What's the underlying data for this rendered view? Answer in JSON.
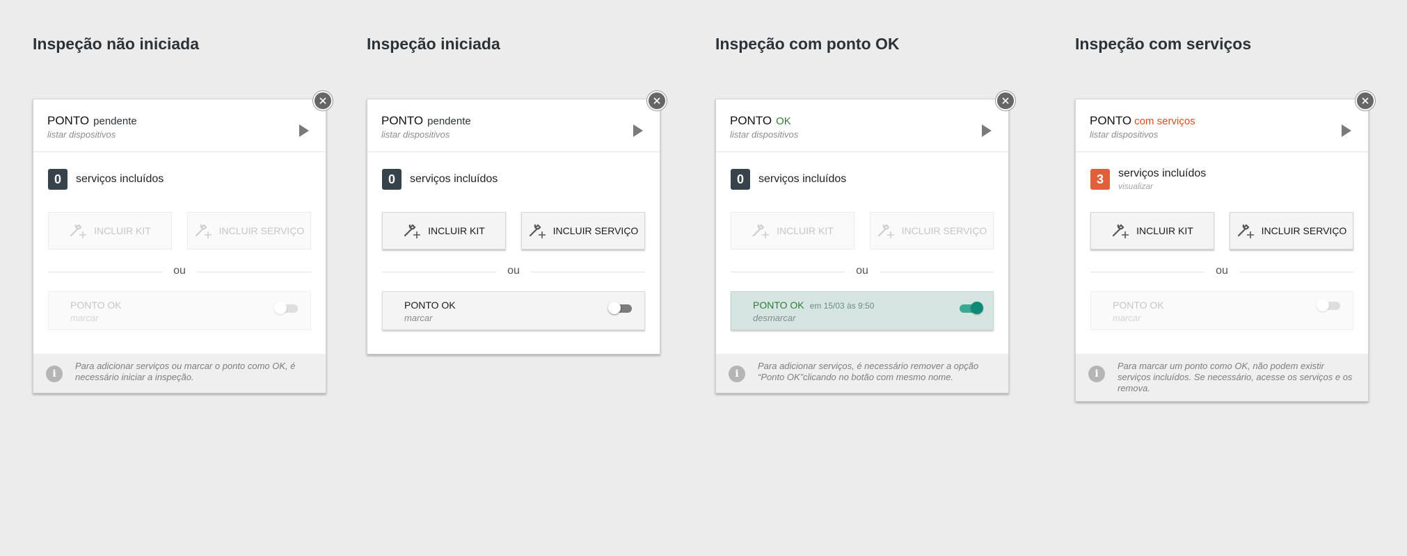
{
  "columns": [
    {
      "heading": "Inspeção não iniciada",
      "point_label": "PONTO",
      "point_status": "pendente",
      "list_devices": "listar dispositivos",
      "services_count": "0",
      "services_label": "serviços incluídos",
      "include_kit": "INCLUIR KIT",
      "include_service": "INCLUIR SERVIÇO",
      "or_label": "ou",
      "point_ok_label": "PONTO OK",
      "point_ok_sub": "marcar",
      "footer_text": "Para adicionar serviços ou marcar o ponto como OK, é necessário iniciar a inspeção."
    },
    {
      "heading": "Inspeção iniciada",
      "point_label": "PONTO",
      "point_status": "pendente",
      "list_devices": "listar dispositivos",
      "services_count": "0",
      "services_label": "serviços incluídos",
      "include_kit": "INCLUIR KIT",
      "include_service": "INCLUIR SERVIÇO",
      "or_label": "ou",
      "point_ok_label": "PONTO OK",
      "point_ok_sub": "marcar"
    },
    {
      "heading": "Inspeção com ponto OK",
      "point_label": "PONTO",
      "point_status": "OK",
      "list_devices": "listar dispositivos",
      "services_count": "0",
      "services_label": "serviços incluídos",
      "include_kit": "INCLUIR KIT",
      "include_service": "INCLUIR SERVIÇO",
      "or_label": "ou",
      "point_ok_label": "PONTO OK",
      "point_ok_date": "em 15/03 às 9:50",
      "point_ok_sub": "desmarcar",
      "footer_text": "Para adicionar serviços, é necessário remover a opção “Ponto OK”clicando no botão com mesmo nome."
    },
    {
      "heading": "Inspeção com serviços",
      "point_label": "PONTO",
      "point_status": "com serviços",
      "list_devices": "listar dispositivos",
      "services_count": "3",
      "services_label": "serviços incluídos",
      "services_sub": "visualizar",
      "include_kit": "INCLUIR KIT",
      "include_service": "INCLUIR SERVIÇO",
      "or_label": "ou",
      "point_ok_label": "PONTO OK",
      "point_ok_sub": "marcar",
      "footer_text": "Para marcar um ponto como OK, não podem existir serviços incluídos. Se necessário, acesse os serviços e os remova."
    }
  ],
  "icons": {
    "close": "close-icon",
    "arrow": "play-arrow-icon",
    "tool": "wrench-add-icon",
    "info": "info-icon"
  },
  "colors": {
    "background": "#ececec",
    "badge_dark": "#37434b",
    "badge_orange": "#e0603c",
    "ok_green": "#2e7d32",
    "services_orange": "#d94e1c",
    "ok_row_bg": "#d7e5e2",
    "toggle_on": "#0f8a76"
  }
}
